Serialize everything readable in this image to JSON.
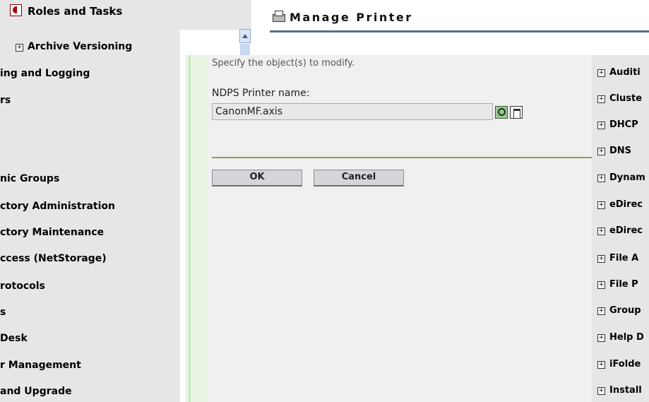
{
  "left_nav": {
    "tab_label": "Roles and Tasks",
    "archive_label": "Archive Versioning",
    "items": [
      "ing and Logging",
      "rs",
      "",
      "",
      "nic Groups",
      "ctory Administration",
      "ctory Maintenance",
      "ccess (NetStorage)",
      "rotocols",
      "s",
      "Desk",
      "r Management",
      " and Upgrade"
    ]
  },
  "header": {
    "title": "Manage Printer"
  },
  "form": {
    "instruction": "Specify the object(s) to modify.",
    "field_label": "NDPS Printer name:",
    "field_value": "CanonMF.axis",
    "ok_label": "OK",
    "cancel_label": "Cancel"
  },
  "right_nav": {
    "items": [
      "Auditi",
      "Cluste",
      "DHCP",
      "DNS",
      "Dynam",
      "eDirec",
      "eDirec",
      "File A",
      "File P",
      "Group",
      "Help D",
      "iFolde",
      "Install"
    ]
  },
  "colors": {
    "nav_bg": "#e6e6e6",
    "title_rule": "#596f8a",
    "accent_green": "#c7e8c0"
  },
  "icons": [
    "roles-icon",
    "plus-icon",
    "printer-icon",
    "search-icon",
    "browse-icon",
    "scroll-up-icon"
  ]
}
